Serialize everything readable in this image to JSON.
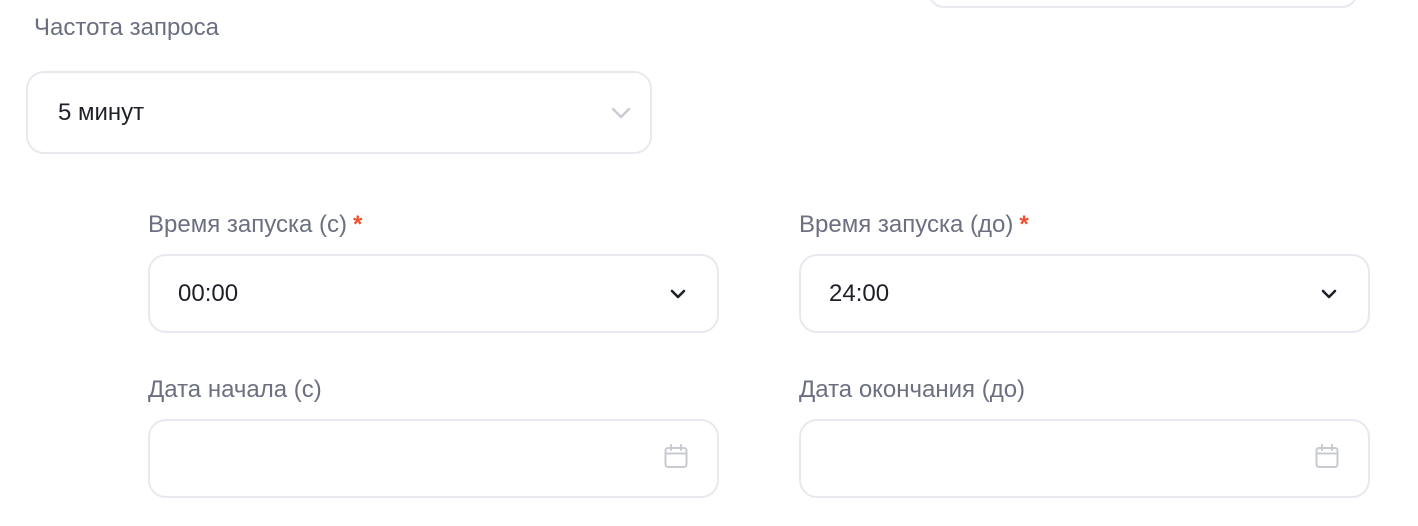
{
  "frequency": {
    "label": "Частота запроса",
    "value": "5 минут"
  },
  "start_time": {
    "label": "Время запуска (с)",
    "required_mark": "*",
    "value": "00:00"
  },
  "end_time": {
    "label": "Время запуска (до)",
    "required_mark": "*",
    "value": "24:00"
  },
  "start_date": {
    "label": "Дата начала (с)",
    "value": ""
  },
  "end_date": {
    "label": "Дата окончания (до)",
    "value": ""
  },
  "colors": {
    "label": "#6b6f80",
    "text": "#1f2129",
    "border": "#e8e9ee",
    "required": "#f0502e",
    "muted_icon": "#c9cbd3"
  },
  "icons": {
    "select": "chevron-down-icon",
    "date": "calendar-icon"
  }
}
